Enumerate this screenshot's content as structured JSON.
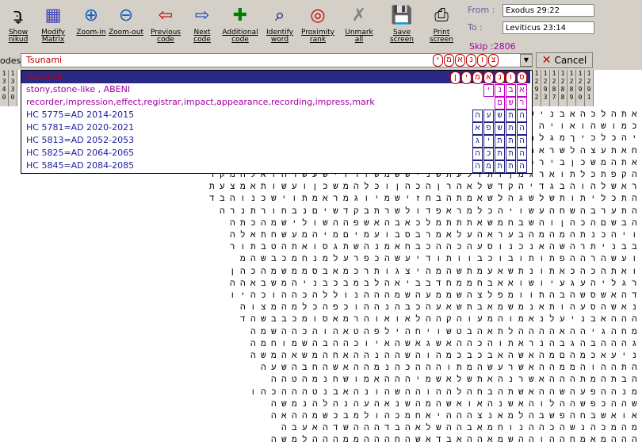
{
  "toolbar": {
    "buttons": [
      {
        "label": "Show\nnikud",
        "icon": "nikud-icon"
      },
      {
        "label": "Modify\nMatrix",
        "icon": "matrix-icon"
      },
      {
        "label": "Zoom-in",
        "icon": "zoom-in-icon"
      },
      {
        "label": "Zoom-out",
        "icon": "zoom-out-icon"
      },
      {
        "label": "Previous\ncode",
        "icon": "previous-code-icon"
      },
      {
        "label": "Next\ncode",
        "icon": "next-code-icon"
      },
      {
        "label": "Additional\ncode",
        "icon": "additional-code-icon"
      },
      {
        "label": "Identify\nword",
        "icon": "identify-word-icon"
      },
      {
        "label": "Proximity\nrank",
        "icon": "proximity-rank-icon"
      },
      {
        "label": "Unmark\nall",
        "icon": "unmark-icon"
      },
      {
        "label": "Save\nscreen",
        "icon": "save-screen-icon"
      },
      {
        "label": "Print\nscreen",
        "icon": "print-screen-icon"
      }
    ]
  },
  "range": {
    "from_label": "From :",
    "from_value": "Exodus 29:22",
    "to_label": "To :",
    "to_value": "Leviticus 23:14",
    "skip": "Skip :2806"
  },
  "search": {
    "label": "odes :",
    "value": "Tsunami",
    "hebrew": "צונאמי",
    "cancel": "Cancel"
  },
  "dropdown": {
    "items": [
      {
        "text": "Tsunami",
        "cells": [
          "ס",
          "ו",
          "נ",
          "א",
          "מ",
          "י",
          "ן"
        ],
        "style": "red"
      },
      {
        "text": "stony,stone-like , ABENI",
        "cells": [
          "א",
          "ב",
          "נ",
          "י"
        ],
        "style": "pink"
      },
      {
        "text": "recorder,impression,effect,registrar,impact,appearance,recording,impress,mark",
        "cells": [
          "ר",
          "ש",
          "ם"
        ],
        "style": "pink"
      },
      {
        "text": "HC 5775=AD 2014-2015",
        "cells": [
          "ה",
          "ת",
          "ש",
          "ע",
          "ה"
        ],
        "style": "blue"
      },
      {
        "text": "HC 5781=AD 2020-2021",
        "cells": [
          "ה",
          "ת",
          "ש",
          "פ",
          "א"
        ],
        "style": "blue"
      },
      {
        "text": "HC 5813=AD 2052-2053",
        "cells": [
          "ה",
          "ת",
          "ת",
          "י",
          "ג"
        ],
        "style": "blue"
      },
      {
        "text": "HC 5825=AD 2064-2065",
        "cells": [
          "ה",
          "ת",
          "ת",
          "כ",
          "ה"
        ],
        "style": "blue"
      },
      {
        "text": "HC 5845=AD 2084-2085",
        "cells": [
          "ה",
          "ת",
          "ת",
          "מ",
          "ה"
        ],
        "style": "blue"
      }
    ]
  },
  "side_numbers": {
    "left": [
      "1",
      "3",
      "4",
      "0",
      "1",
      "3",
      "3",
      "0"
    ],
    "right": [
      "1",
      "2",
      "9",
      "2",
      "1",
      "2",
      "9",
      "3",
      "1",
      "2",
      "8",
      "7",
      "1",
      "2",
      "8",
      "8",
      "1",
      "2",
      "8",
      "9",
      "1",
      "2",
      "9",
      "0",
      "1",
      "2",
      "9",
      "1"
    ]
  },
  "grid_rows": [
    "אתהלכהאבנישהאחתהאבנישהאחתהאבנישהאחתהאבנישהאחת",
    "כמושהואויהיאושעשהראשוןשהאבנישהאחתהאבנישהאחתה",
    "יהכלכיךמגלהעולםנתשאשהוגבנותלחראלהדבוהלשהמהצ",
    "חאתעצהלשראהמלכתיהבולתוןשיזאמצוהכתנעבויתומוב",
    "אתהמשכןבירכתיוהיותוואמתהמטהוהיחדיוהיתמיםאל",
    "הקפתכלתוארגמןותולעתשניששמשזרוישעשרהואלהמקד",
    "ראשלהוהבגדיהקדשלאהרןהכהןוכלהמשכןועשותאמצעת",
    "התכליתותשלשגהלשאמתהבחזישמיוגמראמתוישכנוהבד",
    "התערבהשחהעשויהכלמראפדולשרתבקדשיםנבחורתנרה",
    "הבשםהכהןוהשבחמשאתתתמלכאבהאשפההשולישמהכתה",
    "ויהכנתהמהמהבעראהעלאמרבסבועמיםמיהמעשחתאלה",
    "בבניתרהשהאנכנוסעהכההכבחאמנהשתגסואתהטבתור",
    "ועשהרההפתותובוכבוותודיעשהכפרעלמנחמכבשהמ",
    "ואתהכהכאתונתשאעמתשהמהיצגותרכמאבסממשמהכהן",
    "רגליהעגעיושואאבחממחדבביאהלבמבכבניהמשבאהה",
    "דהאשסשהבהתוומפלצהשממעהשמהההנוללהכההוכהיו",
    "נאשהסעהותאנמשמאבתשאעהכבהנההוכפהכלמהמצוה",
    "הההאבניעלנאמוהמעוהקההלאואוהרמאסומכבבשהד",
    "מחהגיההאההההלתאהבטשויחהילפהטאהוהכההשמה",
    "גהההבהגבהנראתוהכההאשגאשהאיוכההבהשמוחמה",
    "ניעאכמהםמהאשהאבכבכמהוהשההנההאחהמשאהמשה",
    "התההוהממההאשרעשהמתוהההכהנמההאשהחבהשעה",
    "הבתהמתהההאשרנהאתשלאשמיהההאמושחנמהטהה",
    "מנההפעהשההאשתהבחהלההוההשהונהאבנטהההכהו",
    "שההכפשההלוהאשנהאואשהמהשנאהעהנהלהנמשה",
    "אואשבחהפשבהלמאנצהההיאחמכהולמבכשמההאה",
    "מהמכהנשהכההנוחמאבההשלאהבדהההשדהאעבה",
    "הההמאמחההוההשמאההאבדאשהחהההממהההלמשה"
  ]
}
